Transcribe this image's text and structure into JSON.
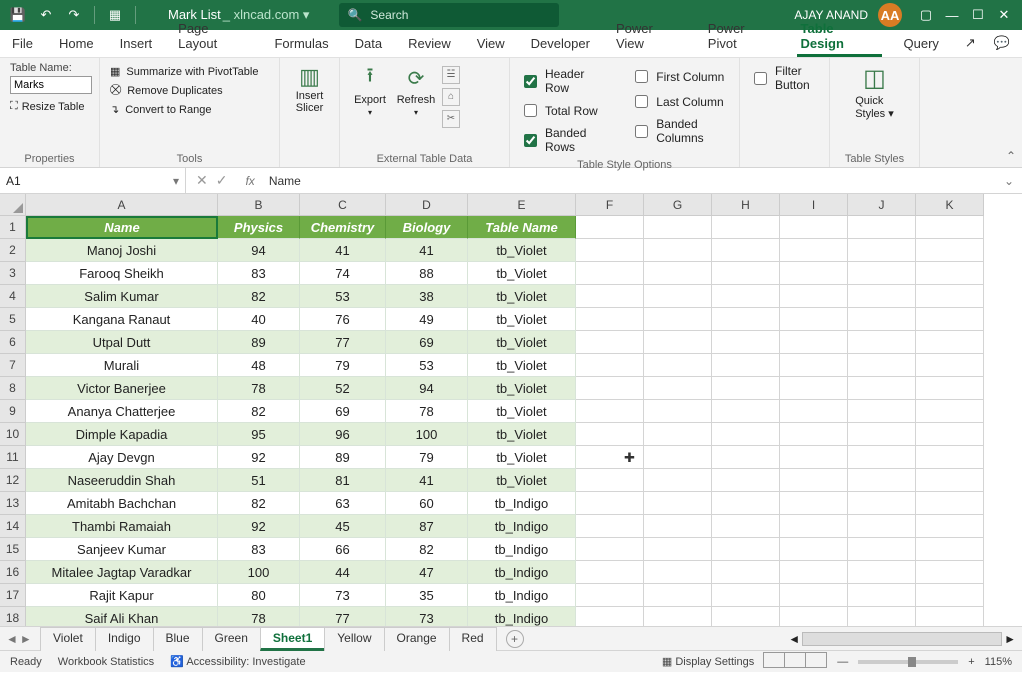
{
  "title": {
    "doc": "Mark List",
    "source": "_ xlncad.com ▾"
  },
  "search": {
    "placeholder": "Search"
  },
  "user": {
    "name": "AJAY ANAND",
    "initials": "AA"
  },
  "tabs": [
    "File",
    "Home",
    "Insert",
    "Page Layout",
    "Formulas",
    "Data",
    "Review",
    "View",
    "Developer",
    "Power View",
    "Power Pivot",
    "Table Design",
    "Query"
  ],
  "active_tab": "Table Design",
  "ribbon": {
    "properties": {
      "label": "Properties",
      "table_name_label": "Table Name:",
      "table_name": "Marks",
      "resize": "Resize Table"
    },
    "tools": {
      "label": "Tools",
      "pivot": "Summarize with PivotTable",
      "dupes": "Remove Duplicates",
      "range": "Convert to Range",
      "slicer": "Insert\nSlicer"
    },
    "external": {
      "label": "External Table Data",
      "export": "Export",
      "refresh": "Refresh"
    },
    "style_opts": {
      "label": "Table Style Options",
      "header_row": "Header Row",
      "total_row": "Total Row",
      "banded_rows": "Banded Rows",
      "first_col": "First Column",
      "last_col": "Last Column",
      "banded_cols": "Banded Columns",
      "filter": "Filter Button"
    },
    "styles": {
      "label": "Table Styles",
      "quick": "Quick\nStyles ▾"
    }
  },
  "name_box": "A1",
  "formula": "Name",
  "columns": [
    "A",
    "B",
    "C",
    "D",
    "E",
    "F",
    "G",
    "H",
    "I",
    "J",
    "K"
  ],
  "headers": [
    "Name",
    "Physics",
    "Chemistry",
    "Biology",
    "Table Name"
  ],
  "rows": [
    {
      "n": "Manoj Joshi",
      "p": 94,
      "c": 41,
      "b": 41,
      "t": "tb_Violet"
    },
    {
      "n": "Farooq Sheikh",
      "p": 83,
      "c": 74,
      "b": 88,
      "t": "tb_Violet"
    },
    {
      "n": "Salim Kumar",
      "p": 82,
      "c": 53,
      "b": 38,
      "t": "tb_Violet"
    },
    {
      "n": "Kangana Ranaut",
      "p": 40,
      "c": 76,
      "b": 49,
      "t": "tb_Violet"
    },
    {
      "n": "Utpal Dutt",
      "p": 89,
      "c": 77,
      "b": 69,
      "t": "tb_Violet"
    },
    {
      "n": "Murali",
      "p": 48,
      "c": 79,
      "b": 53,
      "t": "tb_Violet"
    },
    {
      "n": "Victor Banerjee",
      "p": 78,
      "c": 52,
      "b": 94,
      "t": "tb_Violet"
    },
    {
      "n": "Ananya Chatterjee",
      "p": 82,
      "c": 69,
      "b": 78,
      "t": "tb_Violet"
    },
    {
      "n": "Dimple Kapadia",
      "p": 95,
      "c": 96,
      "b": 100,
      "t": "tb_Violet"
    },
    {
      "n": "Ajay Devgn",
      "p": 92,
      "c": 89,
      "b": 79,
      "t": "tb_Violet"
    },
    {
      "n": "Naseeruddin Shah",
      "p": 51,
      "c": 81,
      "b": 41,
      "t": "tb_Violet"
    },
    {
      "n": "Amitabh Bachchan",
      "p": 82,
      "c": 63,
      "b": 60,
      "t": "tb_Indigo"
    },
    {
      "n": "Thambi Ramaiah",
      "p": 92,
      "c": 45,
      "b": 87,
      "t": "tb_Indigo"
    },
    {
      "n": "Sanjeev Kumar",
      "p": 83,
      "c": 66,
      "b": 82,
      "t": "tb_Indigo"
    },
    {
      "n": "Mitalee Jagtap Varadkar",
      "p": 100,
      "c": 44,
      "b": 47,
      "t": "tb_Indigo"
    },
    {
      "n": "Rajit Kapur",
      "p": 80,
      "c": 73,
      "b": 35,
      "t": "tb_Indigo"
    },
    {
      "n": "Saif Ali Khan",
      "p": 78,
      "c": 77,
      "b": 73,
      "t": "tb_Indigo"
    }
  ],
  "sheet_tabs": [
    "Violet",
    "Indigo",
    "Blue",
    "Green",
    "Sheet1",
    "Yellow",
    "Orange",
    "Red"
  ],
  "active_sheet": "Sheet1",
  "status": {
    "ready": "Ready",
    "wb_stats": "Workbook Statistics",
    "access": "Accessibility: Investigate",
    "zoom": "115%",
    "disp": "Display Settings"
  }
}
